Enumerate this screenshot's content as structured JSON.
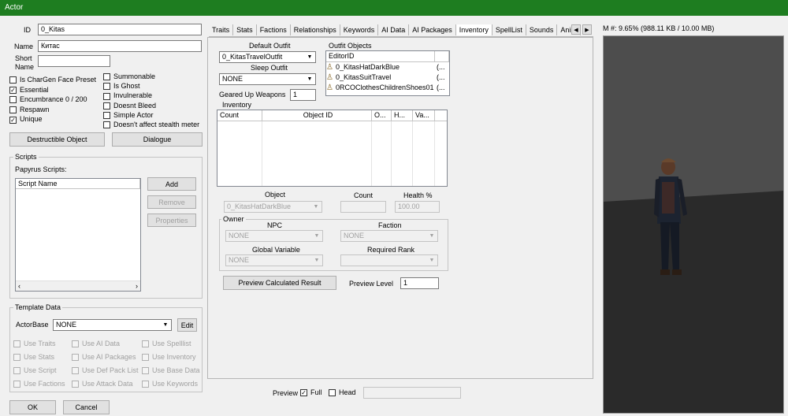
{
  "window": {
    "title": "Actor"
  },
  "basic": {
    "id_label": "ID",
    "id_value": "0_Kitas",
    "name_label": "Name",
    "name_value": "Китас",
    "short_label": "Short",
    "short_label2": "Name",
    "short_value": ""
  },
  "flags_left": [
    {
      "label": "Is CharGen Face Preset",
      "checked": false
    },
    {
      "label": "Essential",
      "checked": true
    },
    {
      "label": "Encumbrance 0 / 200",
      "checked": false
    },
    {
      "label": "Respawn",
      "checked": false
    },
    {
      "label": "Unique",
      "checked": true
    }
  ],
  "flags_right": [
    {
      "label": "Summonable",
      "checked": false
    },
    {
      "label": "Is Ghost",
      "checked": false
    },
    {
      "label": "Invulnerable",
      "checked": false
    },
    {
      "label": "Doesnt Bleed",
      "checked": false
    },
    {
      "label": "Simple Actor",
      "checked": false
    },
    {
      "label": "Doesn't affect stealth meter",
      "checked": false
    }
  ],
  "buttons": {
    "destructible": "Destructible Object",
    "dialogue": "Dialogue",
    "ok": "OK",
    "cancel": "Cancel"
  },
  "scripts": {
    "group_label": "Scripts",
    "papyrus_label": "Papyrus Scripts:",
    "column": "Script Name",
    "add": "Add",
    "remove": "Remove",
    "properties": "Properties"
  },
  "template": {
    "group_label": "Template Data",
    "actorbase_label": "ActorBase",
    "actorbase_value": "NONE",
    "edit": "Edit",
    "use_flags": [
      "Use Traits",
      "Use AI Data",
      "Use Spelllist",
      "Use Stats",
      "Use AI Packages",
      "Use Inventory",
      "Use Script",
      "Use Def Pack List",
      "Use Base Data",
      "Use Factions",
      "Use Attack Data",
      "Use Keywords"
    ]
  },
  "tabs": [
    "Traits",
    "Stats",
    "Factions",
    "Relationships",
    "Keywords",
    "AI Data",
    "AI Packages",
    "Inventory",
    "SpellList",
    "Sounds",
    "Anim"
  ],
  "active_tab": "Inventory",
  "inventory": {
    "default_outfit_label": "Default Outfit",
    "default_outfit_value": "0_KitasTravelOutfit",
    "sleep_outfit_label": "Sleep Outfit",
    "sleep_outfit_value": "NONE",
    "geared_label": "Geared Up Weapons",
    "geared_value": "1",
    "inventory_label": "Inventory",
    "outfit_objects_label": "Outfit Objects",
    "outfit_columns": [
      "EditorID",
      ""
    ],
    "outfit_rows": [
      {
        "editor_id": "0_KitasHatDarkBlue",
        "extra": "(..."
      },
      {
        "editor_id": "0_KitasSuitTravel",
        "extra": "(..."
      },
      {
        "editor_id": "0RCOClothesChildrenShoes01",
        "extra": "(..."
      }
    ],
    "inventory_columns": [
      "Count",
      "Object ID",
      "O...",
      "H...",
      "Va..."
    ],
    "object_label": "Object",
    "object_value": "0_KitasHatDarkBlue",
    "count_label": "Count",
    "count_value": "",
    "health_label": "Health %",
    "health_value": "100.00",
    "owner_label": "Owner",
    "npc_label": "NPC",
    "npc_value": "NONE",
    "faction_label": "Faction",
    "faction_value": "NONE",
    "global_label": "Global Variable",
    "global_value": "NONE",
    "rank_label": "Required Rank",
    "rank_value": "",
    "preview_btn": "Preview Calculated Result",
    "preview_level_label": "Preview Level",
    "preview_level_value": "1"
  },
  "bottom": {
    "preview_label": "Preview",
    "full_label": "Full",
    "full_checked": true,
    "head_label": "Head",
    "head_checked": false
  },
  "preview_pane": {
    "memory_text": "M #: 9.65% (988.11 KB / 10.00 MB)"
  },
  "colors": {
    "titlebar": "#1e7d20",
    "floor": "#2a2a2a",
    "wall": "#4d4d4d"
  }
}
